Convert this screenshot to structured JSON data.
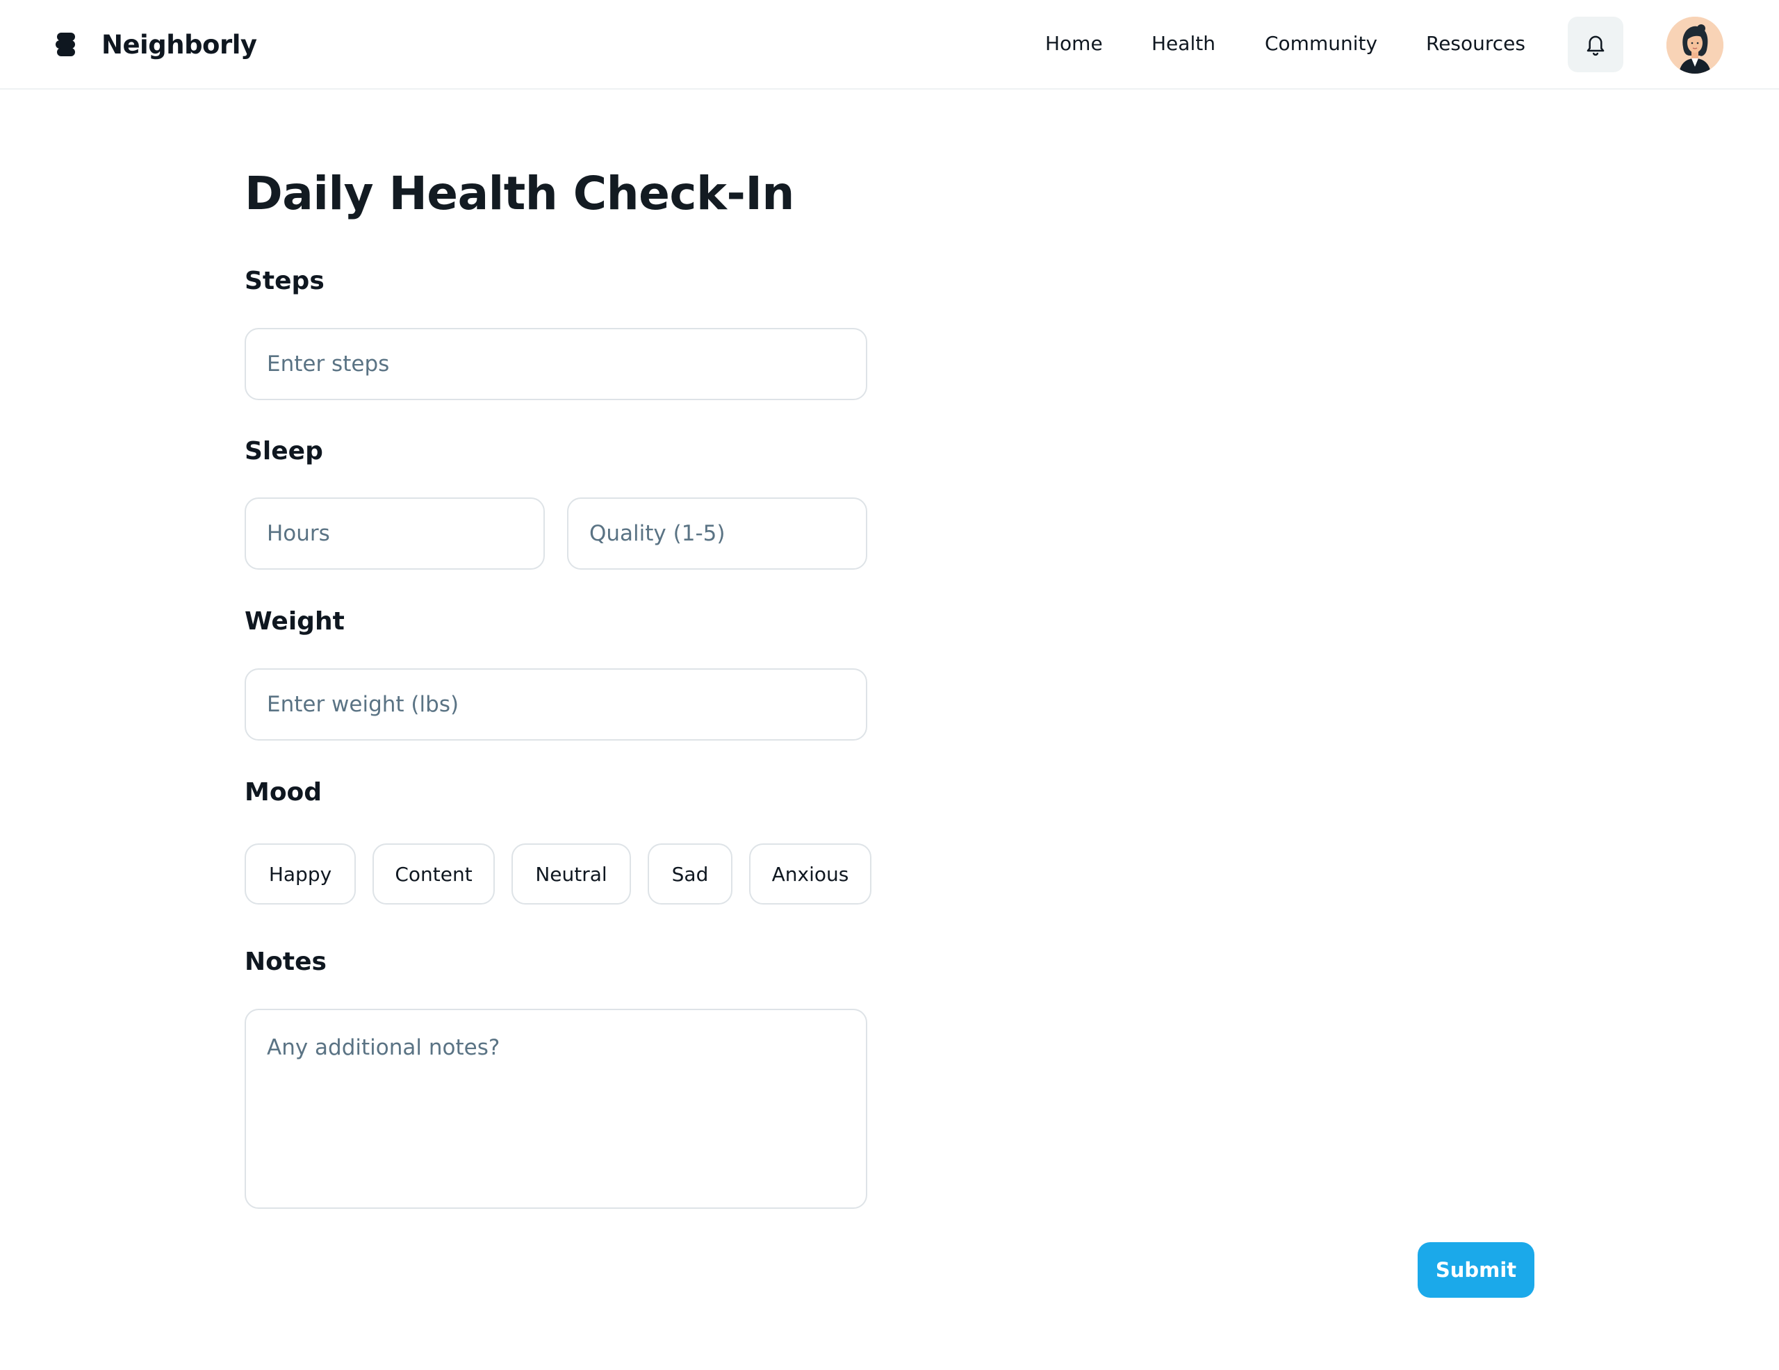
{
  "header": {
    "brand": "Neighborly",
    "nav": [
      "Home",
      "Health",
      "Community",
      "Resources"
    ]
  },
  "page": {
    "title": "Daily Health Check-In"
  },
  "form": {
    "steps": {
      "label": "Steps",
      "placeholder": "Enter steps"
    },
    "sleep": {
      "label": "Sleep",
      "hours_placeholder": "Hours",
      "quality_placeholder": "Quality (1-5)"
    },
    "weight": {
      "label": "Weight",
      "placeholder": "Enter weight (lbs)"
    },
    "mood": {
      "label": "Mood",
      "options": [
        "Happy",
        "Content",
        "Neutral",
        "Sad",
        "Anxious"
      ]
    },
    "notes": {
      "label": "Notes",
      "placeholder": "Any additional notes?"
    },
    "submit_label": "Submit"
  },
  "icons": {
    "brand": "stacked-bars-logo-icon",
    "notifications": "bell-icon",
    "user": "user-avatar"
  },
  "colors": {
    "accent": "#1ba9ea",
    "text": "#0f1720",
    "placeholder": "#5a7384",
    "border": "#dee3e7",
    "icon_button_bg": "#eff3f4",
    "avatar_bg": "#f8d3b6"
  }
}
